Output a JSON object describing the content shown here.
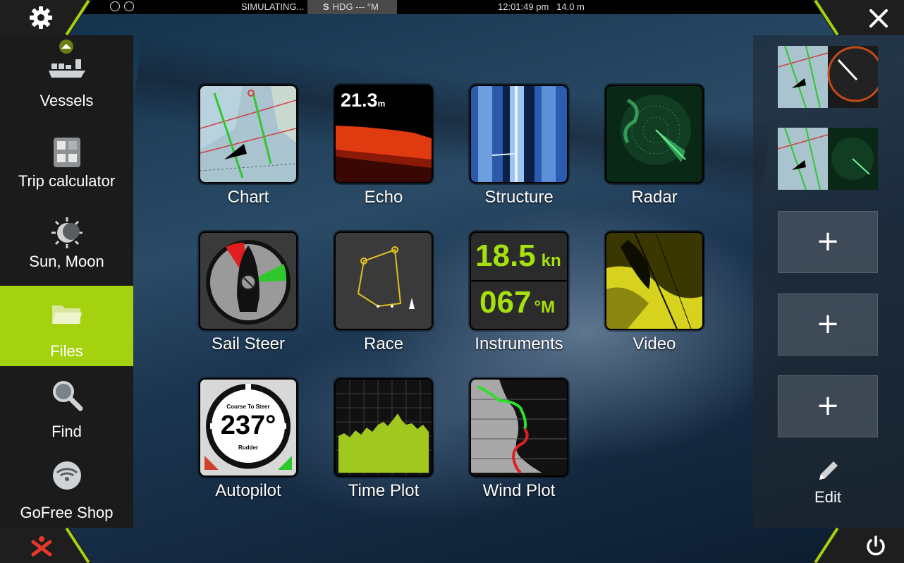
{
  "status_bar": {
    "simulating": "SIMULATING...",
    "heading_source": "S",
    "heading_label": "HDG",
    "heading_value": "--- °M",
    "time": "12:01:49 pm",
    "depth": "14.0 m"
  },
  "corners": {
    "top_left": "settings",
    "top_right": "close",
    "bottom_left": "mob",
    "bottom_right": "power"
  },
  "sidebar": {
    "items": [
      {
        "label": "Vessels",
        "icon": "vessels-icon"
      },
      {
        "label": "Trip calculator",
        "icon": "calculator-icon"
      },
      {
        "label": "Sun, Moon",
        "icon": "sun-moon-icon"
      },
      {
        "label": "Files",
        "icon": "folder-icon",
        "active": true
      },
      {
        "label": "Find",
        "icon": "search-icon"
      },
      {
        "label": "GoFree Shop",
        "icon": "gofree-icon"
      }
    ]
  },
  "apps": [
    {
      "label": "Chart"
    },
    {
      "label": "Echo",
      "value": "21.3",
      "unit": "m"
    },
    {
      "label": "Structure"
    },
    {
      "label": "Radar"
    },
    {
      "label": "Sail Steer"
    },
    {
      "label": "Race"
    },
    {
      "label": "Instruments",
      "speed": "18.5",
      "speed_unit": "kn",
      "heading": "067",
      "heading_unit": "°M"
    },
    {
      "label": "Video"
    },
    {
      "label": "Autopilot",
      "caption": "Course To Steer",
      "value": "237°",
      "sub": "Rudder"
    },
    {
      "label": "Time Plot"
    },
    {
      "label": "Wind Plot"
    }
  ],
  "favorites": {
    "add_label": "+",
    "edit_label": "Edit"
  },
  "colors": {
    "accent": "#a5d20f",
    "active_bg": "#a5d20f",
    "panel": "#1b1b1b"
  }
}
